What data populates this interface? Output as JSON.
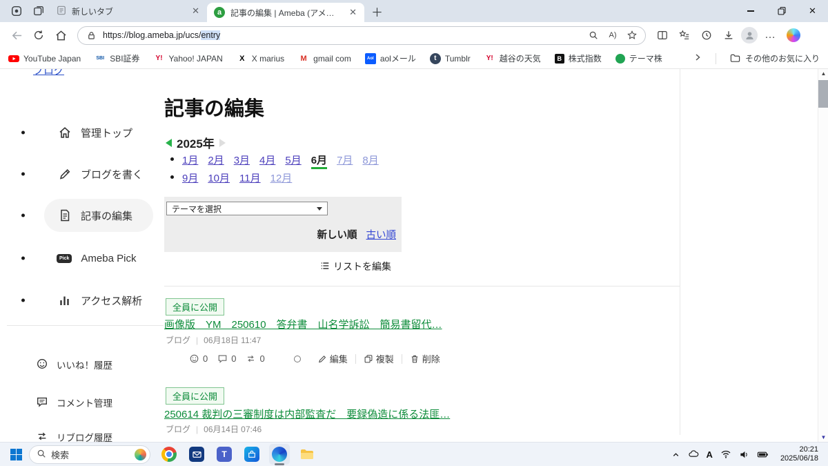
{
  "theme": {
    "accent_green": "#0d8c3a",
    "link_blue": "#2b50c8",
    "visited_purple": "#4c3fbc",
    "tab_bar_bg": "#dce3ec"
  },
  "browser": {
    "tabs": [
      {
        "title": "新しいタブ",
        "active": false
      },
      {
        "title": "記事の編集 | Ameba (アメーバ)",
        "active": true
      }
    ],
    "url_prefix": "https://blog.ameba.jp/ucs/",
    "url_highlight": "entry",
    "favorites": [
      {
        "label": "YouTube Japan",
        "icon": "youtube"
      },
      {
        "label": "SBI証券",
        "icon": "sbi"
      },
      {
        "label": "Yahoo! JAPAN",
        "icon": "yahoo"
      },
      {
        "label": "X marius",
        "icon": "x"
      },
      {
        "label": "gmail com",
        "icon": "gmail"
      },
      {
        "label": "aolメール",
        "icon": "aol"
      },
      {
        "label": "Tumblr",
        "icon": "tumblr"
      },
      {
        "label": "越谷の天気",
        "icon": "yahoo-weather"
      },
      {
        "label": "株式指数",
        "icon": "stock-b"
      },
      {
        "label": "テーマ株",
        "icon": "theme-green"
      }
    ],
    "other_favorites": "その他のお気に入り"
  },
  "page": {
    "back_link": "ブログ",
    "nav_main": [
      {
        "label": "管理トップ"
      },
      {
        "label": "ブログを書く"
      },
      {
        "label": "記事の編集",
        "selected": true
      },
      {
        "label": "Ameba Pick",
        "badge": "Pick"
      },
      {
        "label": "アクセス解析"
      }
    ],
    "nav_sub": [
      {
        "label": "いいね！履歴"
      },
      {
        "label": "コメント管理"
      },
      {
        "label": "リブログ履歴"
      }
    ],
    "heading": "記事の編集",
    "year": "2025年",
    "months_row1": [
      {
        "label": "1月",
        "state": "visited"
      },
      {
        "label": "2月",
        "state": "visited"
      },
      {
        "label": "3月",
        "state": "visited"
      },
      {
        "label": "4月",
        "state": "visited"
      },
      {
        "label": "5月",
        "state": "visited"
      },
      {
        "label": "6月",
        "state": "current"
      },
      {
        "label": "7月",
        "state": "upcoming"
      },
      {
        "label": "8月",
        "state": "upcoming"
      }
    ],
    "months_row2": [
      {
        "label": "9月",
        "state": "visited"
      },
      {
        "label": "10月",
        "state": "visited"
      },
      {
        "label": "11月",
        "state": "visited"
      },
      {
        "label": "12月",
        "state": "upcoming"
      }
    ],
    "theme_select": "テーマを選択",
    "sort_new": "新しい順",
    "sort_old": "古い順",
    "list_edit": "リストを編集",
    "actions": {
      "edit": "編集",
      "copy": "複製",
      "delete": "削除"
    },
    "articles": [
      {
        "badge": "全員に公開",
        "title": "画像版　YM　250610　答弁書　山名学訴訟　簡易書留代…",
        "category": "ブログ",
        "datetime": "06月18日 11:47",
        "reactions": "0",
        "comments": "0",
        "reblogs": "0"
      },
      {
        "badge": "全員に公開",
        "title": "250614 裁判の三審制度は内部監査だ　要録偽造に係る法匪…",
        "category": "ブログ",
        "datetime": "06月14日 07:46"
      }
    ]
  },
  "taskbar": {
    "search": "検索",
    "ime": "A",
    "time": "20:21",
    "date": "2025/06/18"
  }
}
